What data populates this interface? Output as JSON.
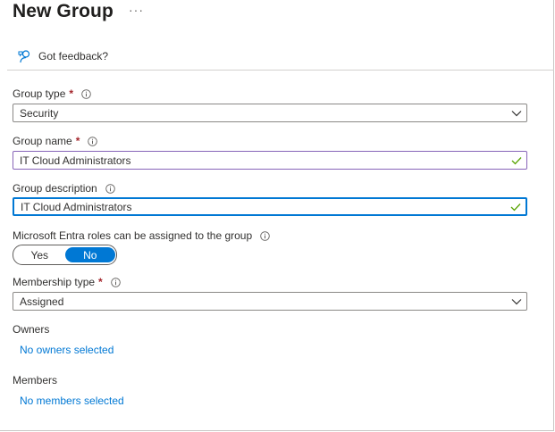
{
  "header": {
    "title": "New Group",
    "more_label": "···"
  },
  "feedback": {
    "label": "Got feedback?",
    "icon": "feedback-icon"
  },
  "form": {
    "group_type": {
      "label": "Group type",
      "required": "*",
      "value": "Security",
      "icon": "chevron-down-icon"
    },
    "group_name": {
      "label": "Group name",
      "required": "*",
      "value": "IT Cloud Administrators",
      "valid_icon": "checkmark-icon"
    },
    "group_description": {
      "label": "Group description",
      "value": "IT Cloud Administrators",
      "valid_icon": "checkmark-icon"
    },
    "entra_roles": {
      "label": "Microsoft Entra roles can be assigned to the group",
      "options": [
        "Yes",
        "No"
      ],
      "selected": "No"
    },
    "membership_type": {
      "label": "Membership type",
      "required": "*",
      "value": "Assigned",
      "icon": "chevron-down-icon"
    },
    "owners": {
      "label": "Owners",
      "link": "No owners selected"
    },
    "members": {
      "label": "Members",
      "link": "No members selected"
    }
  },
  "colors": {
    "accent": "#0078d4",
    "required": "#a4262c",
    "valid": "#57a300",
    "focus_purple": "#8764b8"
  }
}
